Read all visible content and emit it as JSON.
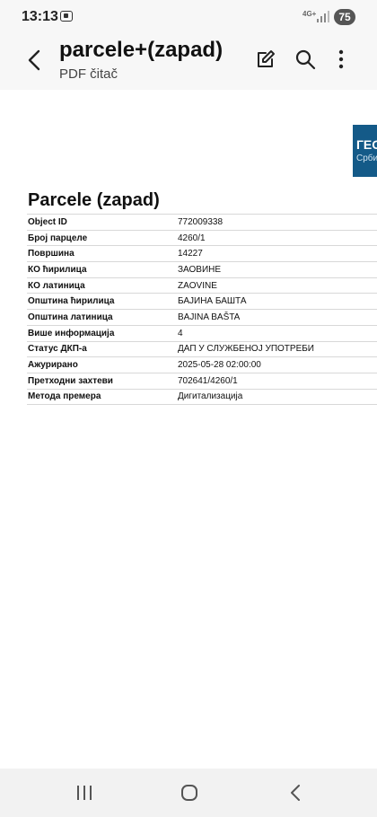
{
  "status_bar": {
    "time": "13:13",
    "network": "4G+",
    "battery": "75"
  },
  "app_bar": {
    "title": "parcele+(zapad)",
    "subtitle": "PDF čitač"
  },
  "document": {
    "logo_text": "ГЕО",
    "logo_subtext": "Србиј",
    "heading": "Parcele (zapad)",
    "rows": [
      {
        "key": "Object ID",
        "value": "772009338"
      },
      {
        "key": "Број парцеле",
        "value": "4260/1"
      },
      {
        "key": "Површина",
        "value": "14227"
      },
      {
        "key": "КО ћирилица",
        "value": "ЗАОВИНЕ"
      },
      {
        "key": "КО латиница",
        "value": "ZAOVINE"
      },
      {
        "key": "Општина ћирилица",
        "value": "БАЈИНА БАШТА"
      },
      {
        "key": "Општина латиница",
        "value": "BAJINA BAŠTA"
      },
      {
        "key": "Више информација",
        "value": "4"
      },
      {
        "key": "Статус ДКП-а",
        "value": "ДАП У СЛУЖБЕНОЈ УПОТРЕБИ"
      },
      {
        "key": "Ажурирано",
        "value": "2025-05-28 02:00:00"
      },
      {
        "key": "Претходни захтеви",
        "value": "702641/4260/1"
      },
      {
        "key": "Метода премера",
        "value": "Дигитализација"
      }
    ]
  },
  "colors": {
    "logo_blue": "#145a88",
    "bar_bg": "#f7f7f7"
  },
  "icons": [
    "back-arrow-icon",
    "edit-icon",
    "search-icon",
    "more-vert-icon",
    "recents-icon",
    "home-icon",
    "nav-back-icon"
  ]
}
